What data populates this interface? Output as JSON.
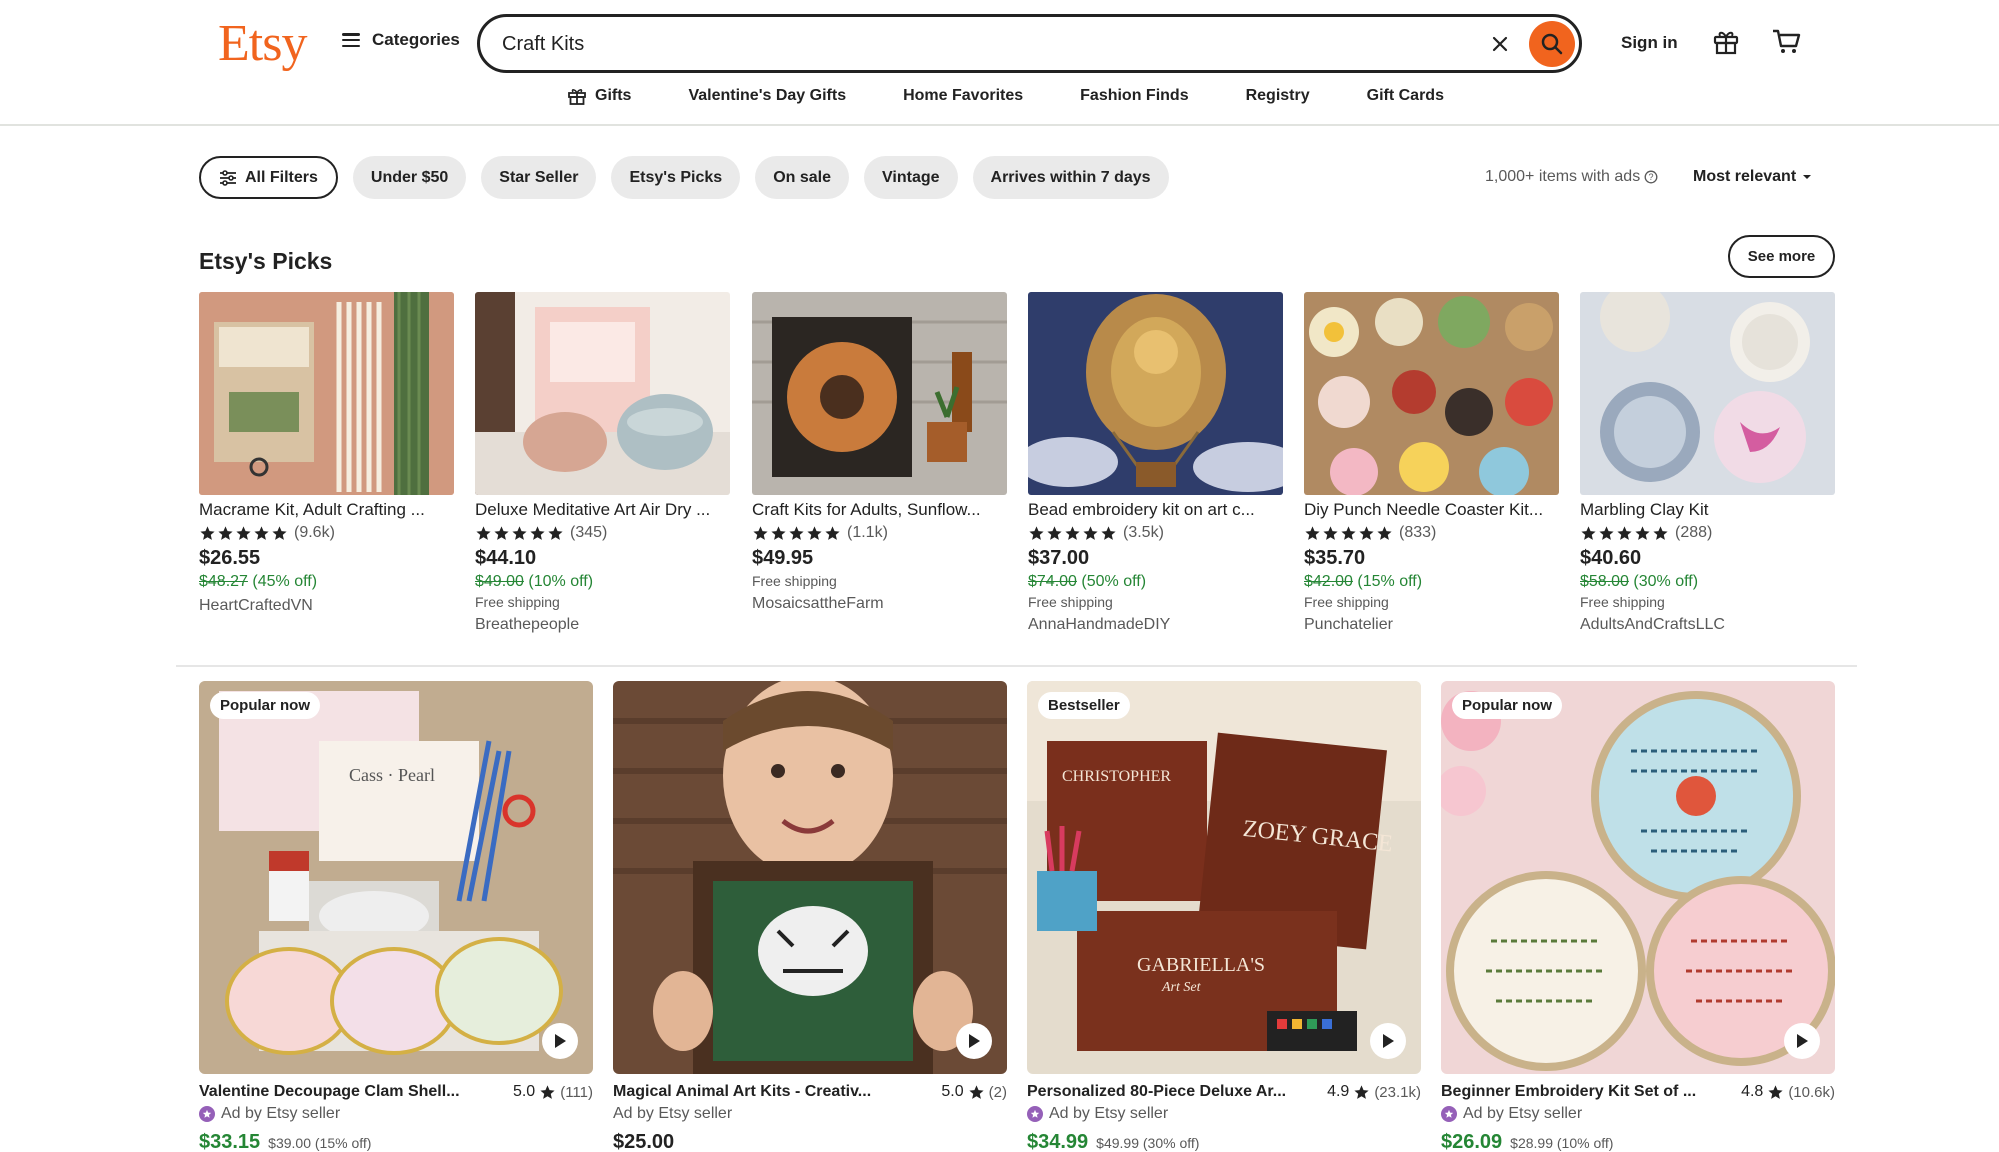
{
  "header": {
    "logo": "Etsy",
    "categories_label": "Categories",
    "search_value": "Craft Kits",
    "signin_label": "Sign in"
  },
  "subnav": {
    "items": [
      "Gifts",
      "Valentine's Day Gifts",
      "Home Favorites",
      "Fashion Finds",
      "Registry",
      "Gift Cards"
    ]
  },
  "filters": {
    "all_filters": "All Filters",
    "chips": [
      "Under $50",
      "Star Seller",
      "Etsy's Picks",
      "On sale",
      "Vintage",
      "Arrives within 7 days"
    ],
    "results_count": "1,000+ items with ads",
    "sort_label": "Most relevant"
  },
  "picks": {
    "title": "Etsy's Picks",
    "see_more": "See more",
    "items": [
      {
        "title": "Macrame Kit, Adult Crafting ...",
        "reviews": "(9.6k)",
        "price": "$26.55",
        "original": "$48.27",
        "discount": "(45% off)",
        "shipping": "",
        "shop": "HeartCraftedVN"
      },
      {
        "title": "Deluxe Meditative Art Air Dry ...",
        "reviews": "(345)",
        "price": "$44.10",
        "original": "$49.00",
        "discount": "(10% off)",
        "shipping": "Free shipping",
        "shop": "Breathepeople"
      },
      {
        "title": "Craft Kits for Adults, Sunflow...",
        "reviews": "(1.1k)",
        "price": "$49.95",
        "original": "",
        "discount": "",
        "shipping": "Free shipping",
        "shop": "MosaicsattheFarm"
      },
      {
        "title": "Bead embroidery kit on art c...",
        "reviews": "(3.5k)",
        "price": "$37.00",
        "original": "$74.00",
        "discount": "(50% off)",
        "shipping": "Free shipping",
        "shop": "AnnaHandmadeDIY"
      },
      {
        "title": "Diy Punch Needle Coaster Kit...",
        "reviews": "(833)",
        "price": "$35.70",
        "original": "$42.00",
        "discount": "(15% off)",
        "shipping": "Free shipping",
        "shop": "Punchatelier"
      },
      {
        "title": "Marbling Clay Kit",
        "reviews": "(288)",
        "price": "$40.60",
        "original": "$58.00",
        "discount": "(30% off)",
        "shipping": "Free shipping",
        "shop": "AdultsAndCraftsLLC"
      }
    ]
  },
  "grid": {
    "items": [
      {
        "badge": "Popular now",
        "title": "Valentine Decoupage Clam Shell...",
        "rating": "5.0",
        "count": "(111)",
        "ad": "Ad by Etsy seller",
        "price": "$33.15",
        "original": "$39.00 (15% off)",
        "sale": true,
        "img_text": "Cass · Pearl"
      },
      {
        "badge": "",
        "title": "Magical Animal Art Kits - Creativ...",
        "rating": "5.0",
        "count": "(2)",
        "ad": "Ad by Etsy seller",
        "price": "$25.00",
        "original": "",
        "sale": false,
        "img_text": ""
      },
      {
        "badge": "Bestseller",
        "title": "Personalized 80-Piece Deluxe Ar...",
        "rating": "4.9",
        "count": "(23.1k)",
        "ad": "Ad by Etsy seller",
        "price": "$34.99",
        "original": "$49.99 (30% off)",
        "sale": true,
        "img_text": "CHRISTOPHER",
        "img_text2": "ZOEY GRACE",
        "img_text3": "GABRIELLA'S",
        "img_text4": "Art Set"
      },
      {
        "badge": "Popular now",
        "title": "Beginner Embroidery Kit Set of ...",
        "rating": "4.8",
        "count": "(10.6k)",
        "ad": "Ad by Etsy seller",
        "price": "$26.09",
        "original": "$28.99 (10% off)",
        "sale": true,
        "img_text": ""
      }
    ]
  },
  "colors": {
    "brand": "#f1641e",
    "sale_green": "#258635",
    "chip_bg": "#eaeaea",
    "ad_purple": "#9560b8"
  }
}
